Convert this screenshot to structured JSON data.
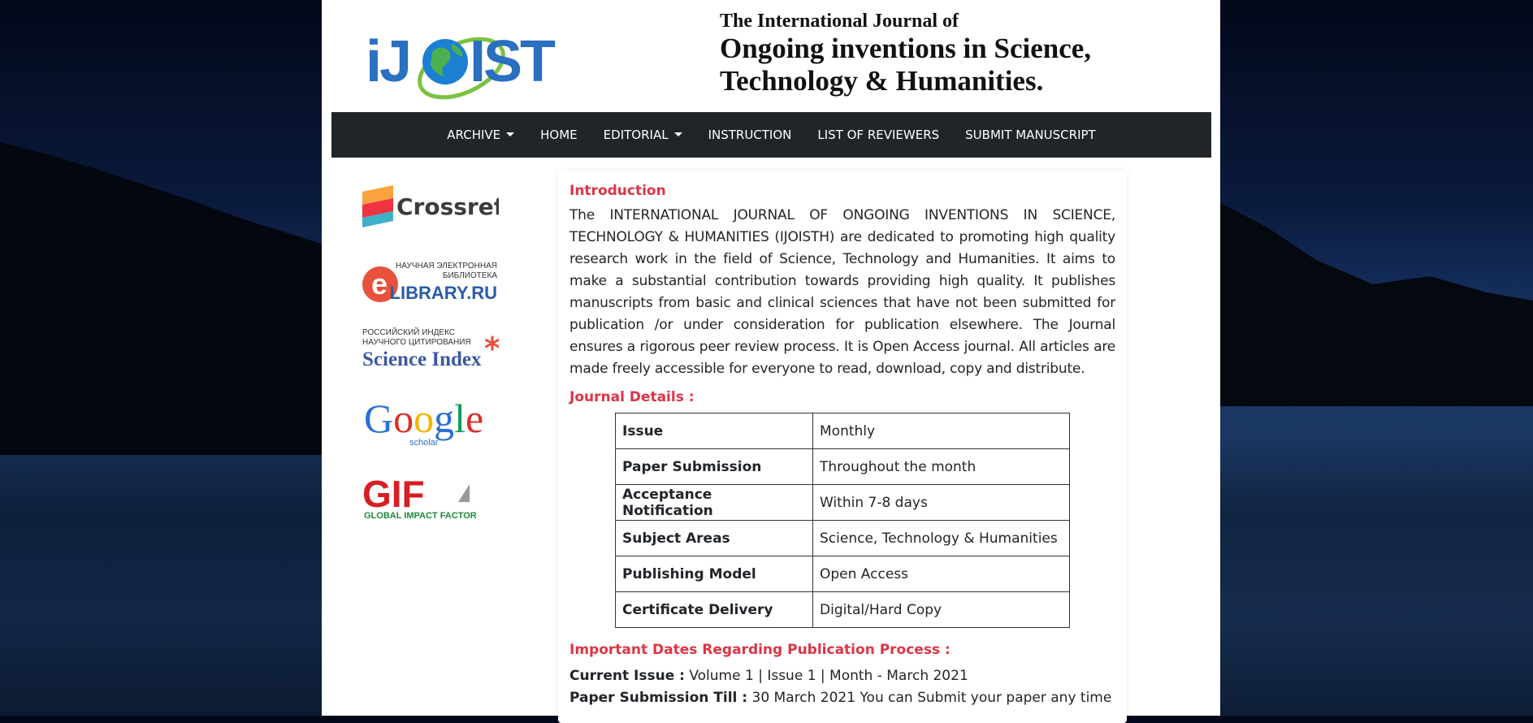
{
  "colors": {
    "accent": "#dc3545",
    "nav_bg": "#212529",
    "brand_blue": "#2a6fc0",
    "brand_green": "#7bc242"
  },
  "header": {
    "logo_text": "iJOIST",
    "title_line1": "The International Journal of",
    "title_line2": "Ongoing inventions in Science,",
    "title_line3": "Technology & Humanities."
  },
  "nav": {
    "items": [
      {
        "label": "ARCHIVE",
        "dropdown": true
      },
      {
        "label": "HOME",
        "dropdown": false
      },
      {
        "label": "EDITORIAL",
        "dropdown": true
      },
      {
        "label": "INSTRUCTION",
        "dropdown": false
      },
      {
        "label": "LIST OF REVIEWERS",
        "dropdown": false
      },
      {
        "label": "SUBMIT MANUSCRIPT",
        "dropdown": false
      }
    ]
  },
  "sidebar": {
    "logos": [
      {
        "name": "crossref-logo",
        "text": "Crossref"
      },
      {
        "name": "elibrary-logo",
        "text_top": "НАУЧНАЯ ЭЛЕКТРОННАЯ",
        "text_mid": "БИБЛИОТЕКА",
        "text_main": "LIBRARY.RU"
      },
      {
        "name": "science-index-logo",
        "text_top": "РОССИЙСКИЙ ИНДЕКС",
        "text_mid": "НАУЧНОГО ЦИТИРОВАНИЯ",
        "text_main": "Science Index"
      },
      {
        "name": "google-scholar-logo",
        "text_main": "Google",
        "text_sub": "scholar"
      },
      {
        "name": "gif-logo",
        "text_main": "GIF",
        "text_sub": "GLOBAL IMPACT FACTOR"
      }
    ]
  },
  "main": {
    "intro_heading": "Introduction",
    "intro_text": "The INTERNATIONAL JOURNAL OF ONGOING INVENTIONS IN SCIENCE, TECHNOLOGY & HUMANITIES (IJOISTH) are dedicated to promoting high quality research work in the field of Science, Technology and Humanities. It aims to make a substantial contribution towards providing high quality. It publishes manuscripts from basic and clinical sciences that have not been submitted for publication /or under consideration for publication elsewhere. The Journal ensures a rigorous peer review process. It is Open Access journal. All articles are made freely accessible for everyone to read, download, copy and distribute.",
    "details_heading": "Journal Details :",
    "details": [
      {
        "key": "Issue",
        "value": "Monthly"
      },
      {
        "key": "Paper Submission",
        "value": "Throughout the month"
      },
      {
        "key": "Acceptance Notification",
        "value": "Within 7-8 days"
      },
      {
        "key": "Subject Areas",
        "value": "Science, Technology & Humanities"
      },
      {
        "key": "Publishing Model",
        "value": "Open Access"
      },
      {
        "key": "Certificate Delivery",
        "value": "Digital/Hard Copy"
      }
    ],
    "dates_heading": "Important Dates Regarding Publication Process :",
    "current_issue_label": "Current Issue :",
    "current_issue_value": "Volume 1 | Issue 1 | Month - March 2021",
    "submission_till_label": "Paper Submission Till :",
    "submission_till_value": "30 March 2021 You can Submit your paper any time"
  }
}
